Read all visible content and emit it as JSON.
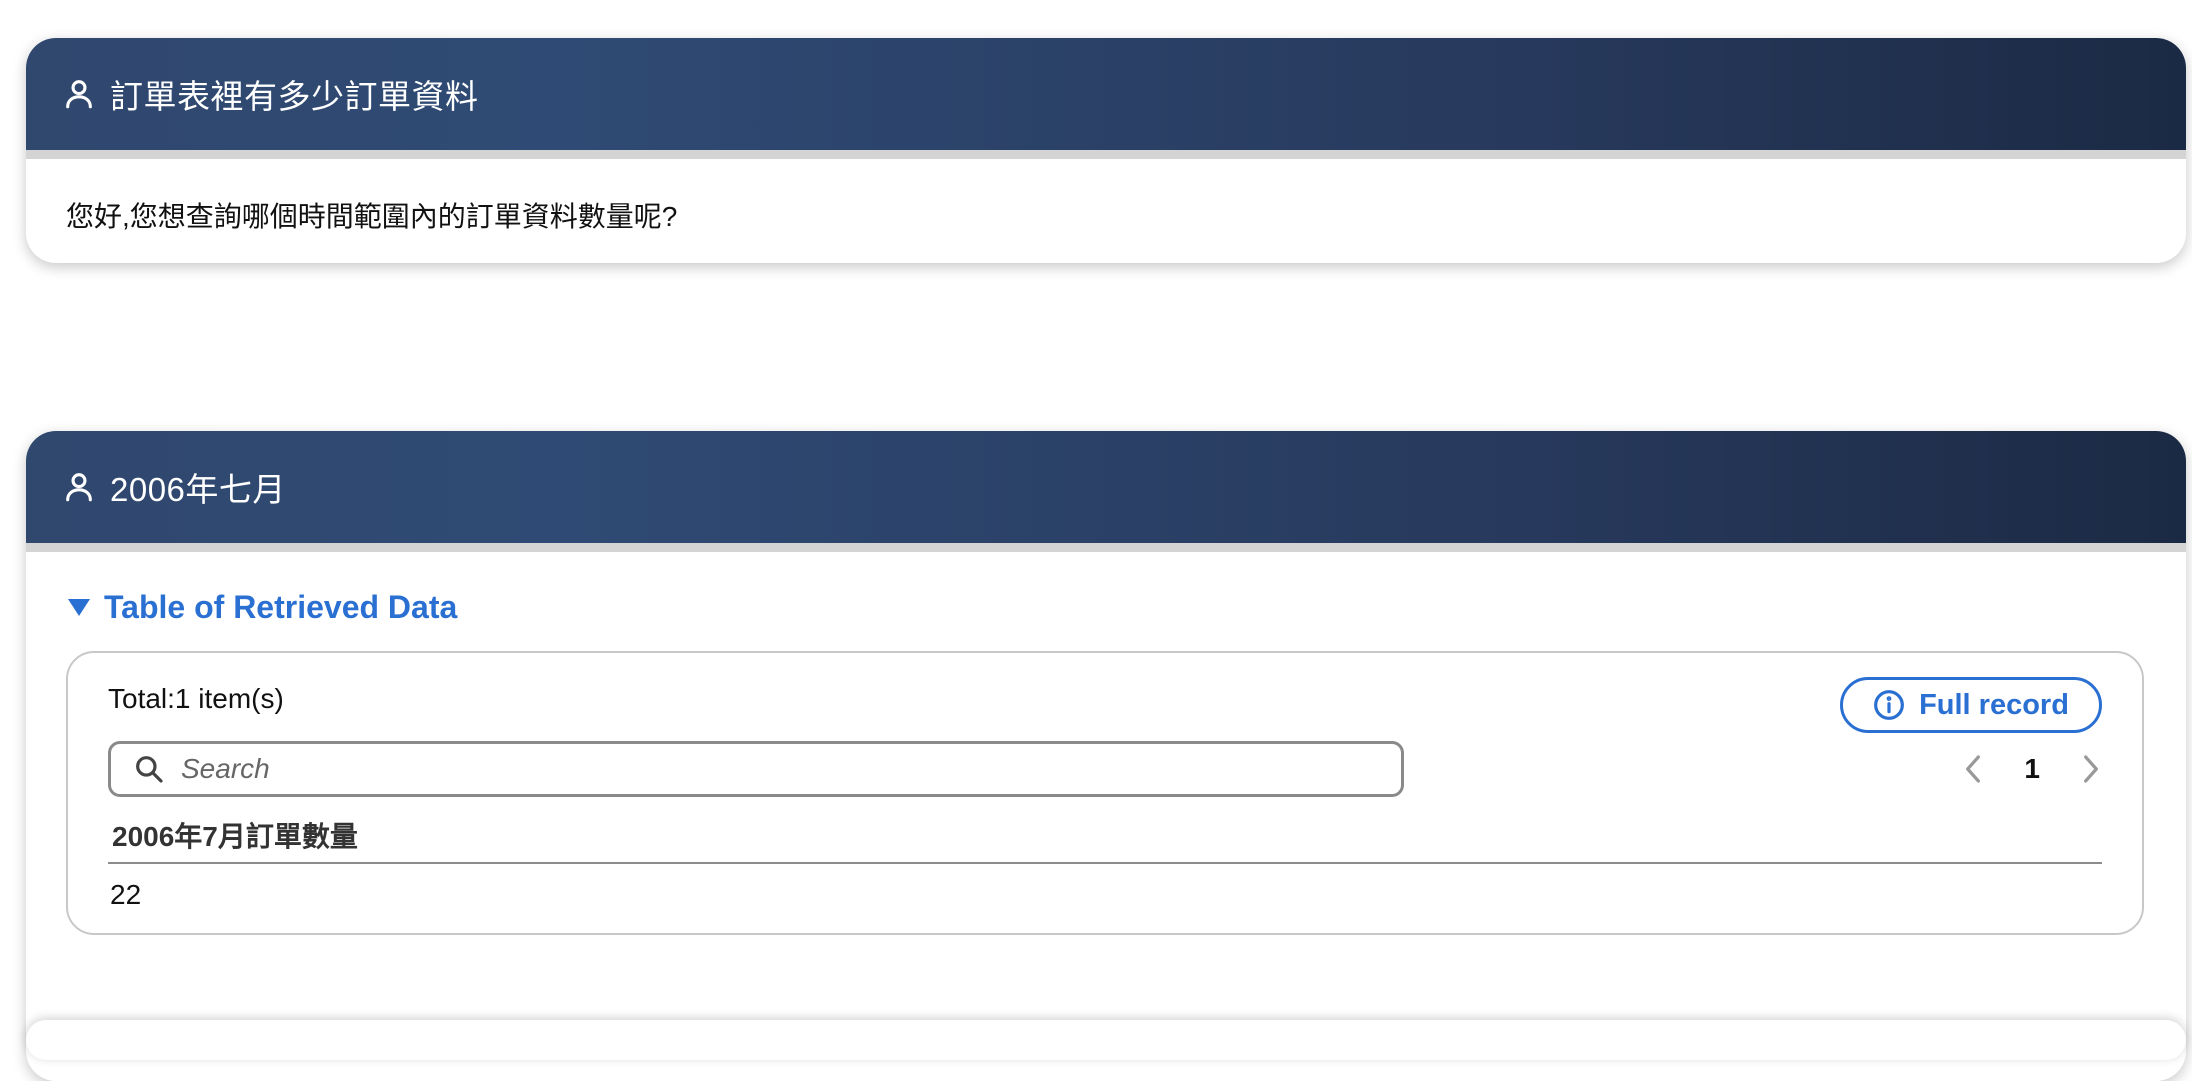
{
  "question_card": {
    "title": "訂單表裡有多少訂單資料",
    "message": "您好,您想查詢哪個時間範圍內的訂單資料數量呢?"
  },
  "answer_card": {
    "title": "2006年七月",
    "section_title": "Table of Retrieved Data",
    "total_label": "Total:1 item(s)",
    "full_record_label": "Full record",
    "search": {
      "placeholder": "Search",
      "value": ""
    },
    "pagination": {
      "current_page": "1"
    },
    "table": {
      "columns": [
        "2006年7月訂單數量"
      ],
      "rows": [
        [
          "22"
        ]
      ]
    }
  },
  "icons": [
    "user-icon",
    "info-icon",
    "search-icon",
    "chevron-left-icon",
    "chevron-right-icon",
    "triangle-down-icon"
  ],
  "colors": {
    "header_start": "#30486e",
    "header_end": "#1b2a44",
    "accent": "#2a6fd2"
  }
}
